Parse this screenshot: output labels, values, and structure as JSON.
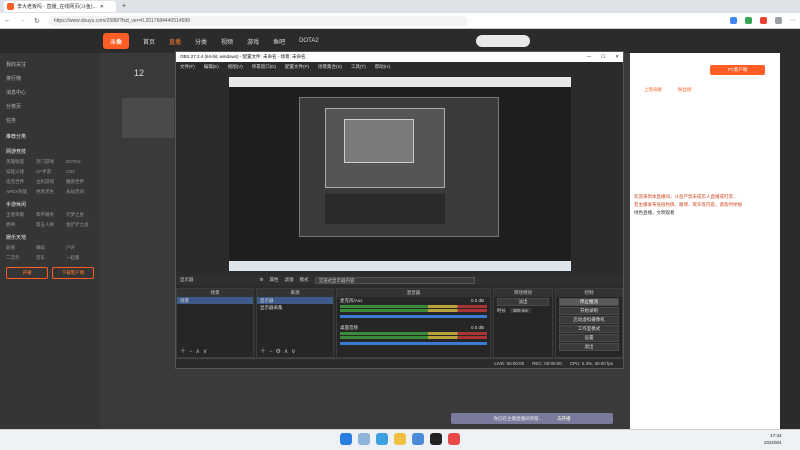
{
  "browser": {
    "tab_title": "李大老板吗 - 直播_在线网页(斗鱼)...",
    "url": "https://www.douyu.com/2588/?fsd_ver=0.2017684440514599",
    "colors": {
      "tabbar": "#dfe3e8",
      "addr": "#ffffff"
    }
  },
  "douyu": {
    "logo_text": "斗鱼",
    "nav": [
      "首页",
      "直播",
      "分类",
      "视频",
      "游戏",
      "鱼吧",
      "DOTA2"
    ],
    "nav_active_index": 1,
    "sidebar": {
      "top_items": [
        "我的关注",
        "排行榜",
        "消息中心",
        "分类页",
        "任务"
      ],
      "sections": [
        {
          "title": "推荐分类",
          "items": []
        },
        {
          "title": "网游竞技",
          "items": [
            "英雄联盟",
            "热门游戏",
            "DOTA2",
            "穿越火线",
            "CF手游",
            "CS2",
            "坦克世界",
            "主机游戏",
            "魔兽世界",
            "APEX英雄",
            "绝地求生",
            "永劫无间"
          ]
        },
        {
          "title": "手游休闲",
          "items": [
            "王者荣耀",
            "和平精英",
            "元梦之星",
            "原神",
            "第五人格",
            "金铲铲之战"
          ]
        },
        {
          "title": "娱乐天地",
          "items": [
            "颜值",
            "舞蹈",
            "户外",
            "二次元",
            "音乐",
            "一起看"
          ]
        }
      ],
      "buttons": [
        "开播",
        "下载客户端"
      ]
    },
    "anchor_count": "12",
    "toast": {
      "text": "你已在主播直播间停留…",
      "action": "去开播"
    },
    "right_panel": {
      "top_btn": "PC客户端",
      "chips": [
        "上周贡献",
        "粉丝榜"
      ],
      "chat": [
        "欢迎来到本直播间，斗鱼严禁未成年人直播或打赏...",
        "若主播发布低俗色情、赌博、欺诈等内容，请及时举报",
        "绿色直播，文明观看"
      ]
    }
  },
  "obs": {
    "title": "OBS 27.2.4 (64-bit, windows) - 配置文件: 未命名 - 场景: 未命名",
    "menu": [
      "文件(F)",
      "编辑(E)",
      "视图(V)",
      "停靠窗口(D)",
      "配置文件(P)",
      "场景集合(S)",
      "工具(T)",
      "帮助(H)"
    ],
    "scene_bar": {
      "scene_label": "显示器",
      "props": "属性",
      "filter": "滤镜",
      "mode_label": "模式",
      "mode_value": "沉浸式显示器内容"
    },
    "docks": {
      "scenes": {
        "title": "场景",
        "items": [
          "场景"
        ]
      },
      "sources": {
        "title": "来源",
        "items": [
          "显示器",
          "显示器采集"
        ]
      },
      "mixer": {
        "title": "混音器",
        "tracks": [
          {
            "name": "麦克风/Aux",
            "db": "0.0 dB"
          },
          {
            "name": "桌面音频",
            "db": "0.0 dB"
          }
        ]
      },
      "transitions": {
        "title": "转场特效",
        "type": "淡出",
        "duration_label": "时长",
        "duration": "300 ms"
      },
      "controls": {
        "title": "控制",
        "buttons": [
          "停止推流",
          "开始录制",
          "启动虚拟摄像机",
          "工作室模式",
          "设置",
          "退出"
        ]
      }
    },
    "status": {
      "live": "LIVE: 00:00:00",
      "rec": "REC: 00:00:00",
      "cpu": "CPU: 0.3%, 30.00 fps"
    }
  },
  "taskbar": {
    "time": "17:34",
    "date": "2022/8/4"
  }
}
